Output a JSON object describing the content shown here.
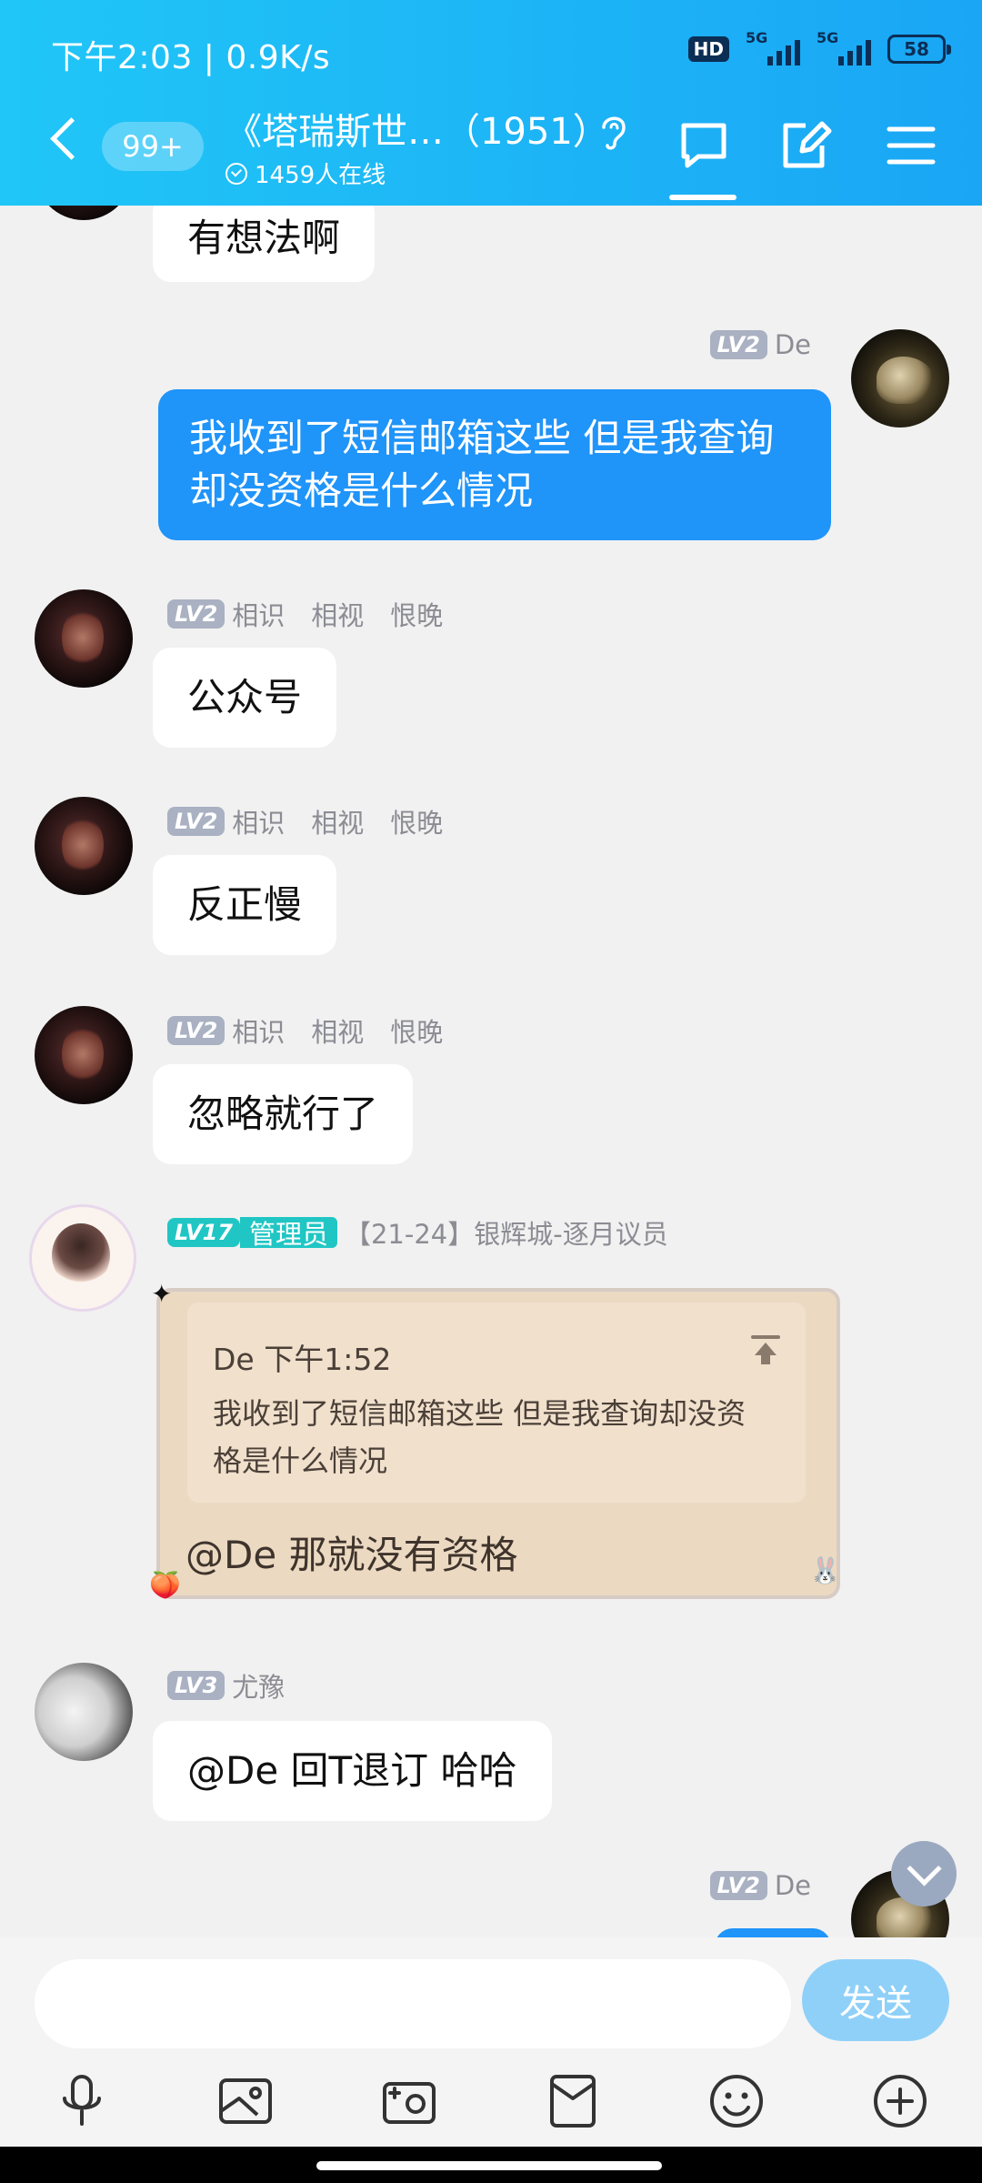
{
  "status_bar": {
    "time": "下午2:03 | 0.9K/s",
    "hd": "HD",
    "network1": "5G",
    "network2": "5G",
    "battery": "58"
  },
  "header": {
    "unread_count": "99+",
    "group_name": "《塔瑞斯世…（1951）",
    "online_count": "1459人在线"
  },
  "messages": [
    {
      "text": "有想法啊"
    },
    {
      "level": "LV2",
      "sender": "De",
      "text": "我收到了短信邮箱这些 但是我查询却没资格是什么情况"
    },
    {
      "level": "LV2",
      "sender": "相识　相视　恨晚",
      "text": "公众号"
    },
    {
      "level": "LV2",
      "sender": "相识　相视　恨晚",
      "text": "反正慢"
    },
    {
      "level": "LV2",
      "sender": "相识　相视　恨晚",
      "text": "忽略就行了"
    },
    {
      "level": "LV17",
      "admin_tag": "管理员",
      "sender": "【21-24】银辉城-逐月议员",
      "quote_header": "De 下午1:52",
      "quote_text": "我收到了短信邮箱这些 但是我查询却没资格是什么情况",
      "text": "@De 那就没有资格"
    },
    {
      "level": "LV3",
      "sender": "尤豫",
      "text": "@De 回T退订  哈哈"
    },
    {
      "level": "LV2",
      "sender": "De"
    }
  ],
  "input": {
    "placeholder": "",
    "send_label": "发送"
  },
  "colors": {
    "header": "#1aa6f5",
    "outgoing_bubble": "#1f94f9",
    "send_button": "#8fd0f9",
    "admin": "#20c6c4"
  }
}
